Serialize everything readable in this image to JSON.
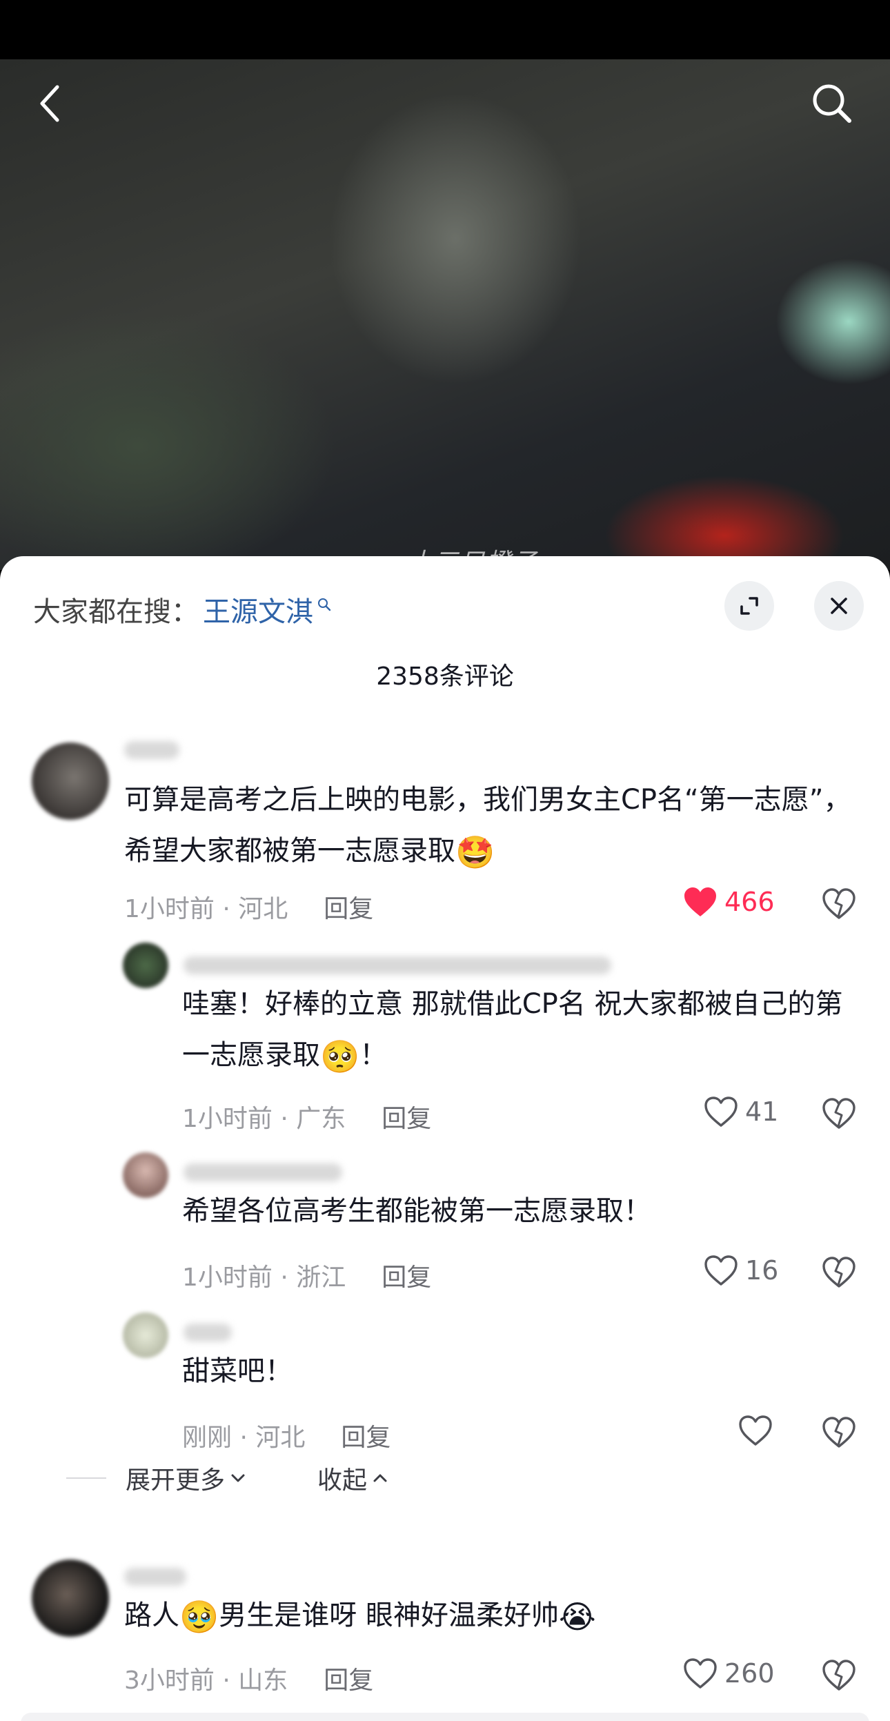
{
  "header": {
    "back_icon": "chevron-left-icon",
    "search_icon": "search-icon"
  },
  "video": {
    "watermark": "十三只橙子"
  },
  "sheet": {
    "search_prefix": "大家都在搜：",
    "search_keyword": "王源文淇",
    "comment_count": "2358条评论",
    "expand_icon": "expand-icon",
    "close_icon": "close-icon"
  },
  "comments": [
    {
      "text": "可算是高考之后上映的电影，我们男女主CP名“第一志愿”，希望大家都被第一志愿录取",
      "emoji": "🤩",
      "time_location": "1小时前 · 河北",
      "reply": "回复",
      "likes": "466",
      "liked": true
    },
    {
      "text": "哇塞！好棒的立意 那就借此CP名 祝大家都被自己的第一志愿录取",
      "emoji": "🥺",
      "text_after": "！",
      "time_location": "1小时前 · 广东",
      "reply": "回复",
      "likes": "41"
    },
    {
      "text": "希望各位高考生都能被第一志愿录取！",
      "time_location": "1小时前 · 浙江",
      "reply": "回复",
      "likes": "16"
    },
    {
      "text": "甜菜吧！",
      "time_location": "刚刚 · 河北",
      "reply": "回复",
      "likes": ""
    },
    {
      "text_before": "路人",
      "emoji_a": "🥹",
      "text": "男生是谁呀 眼神好温柔好帅",
      "emoji": "😭",
      "time_location": "3小时前 · 山东",
      "reply": "回复",
      "likes": "260"
    }
  ],
  "thread": {
    "expand_more": "展开更多",
    "collapse": "收起"
  },
  "colors": {
    "like_red": "#fe2c55",
    "keyword_blue": "#2f63a8",
    "meta_gray": "#9a9ba0"
  }
}
